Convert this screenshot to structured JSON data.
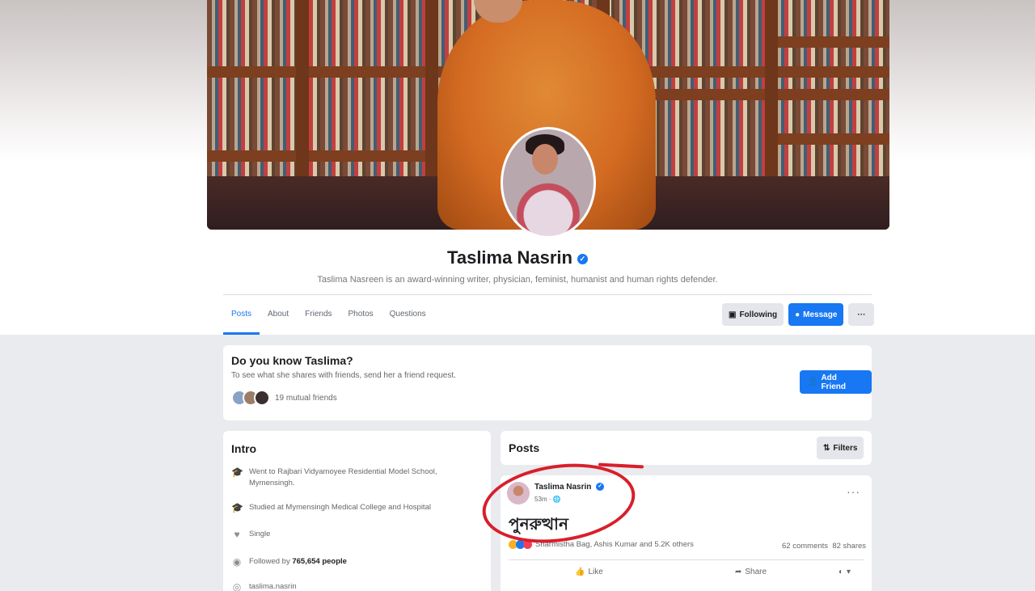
{
  "profile": {
    "name": "Taslima Nasrin",
    "bio": "Taslima Nasreen is an award-winning writer, physician, feminist, humanist and human rights defender."
  },
  "tabs": [
    {
      "label": "Posts"
    },
    {
      "label": "About"
    },
    {
      "label": "Friends"
    },
    {
      "label": "Photos"
    },
    {
      "label": "Questions"
    }
  ],
  "actions": {
    "following": "Following",
    "message": "Message",
    "more": "···"
  },
  "know_card": {
    "title": "Do you know Taslima?",
    "subtitle": "To see what she shares with friends, send her a friend request.",
    "mutual": "19 mutual friends",
    "add_friend": "Add Friend"
  },
  "intro": {
    "title": "Intro",
    "items": [
      {
        "icon": "graduation-cap-icon",
        "text": "Went to Rajbari Vidyamoyee Residential Model School, Mymensingh."
      },
      {
        "icon": "graduation-cap-icon",
        "text": "Studied at Mymensingh Medical College and Hospital"
      },
      {
        "icon": "heart-icon",
        "text": "Single"
      },
      {
        "icon": "rss-icon",
        "prefix": "Followed by",
        "count": "765,654 people"
      },
      {
        "icon": "instagram-icon",
        "text": "taslima.nasrin"
      }
    ]
  },
  "posts": {
    "title": "Posts",
    "filters": "Filters",
    "post": {
      "author": "Taslima Nasrin",
      "time": "53m",
      "text": "পুনরুত্থান",
      "reactions": "Sharmistha Bag, Ashis Kumar and 5.2K others",
      "comments": "62 comments",
      "shares": "82 shares",
      "like": "Like",
      "share": "Share"
    }
  },
  "colors": {
    "accent": "#1877f2",
    "annotation": "#d81f2b"
  }
}
